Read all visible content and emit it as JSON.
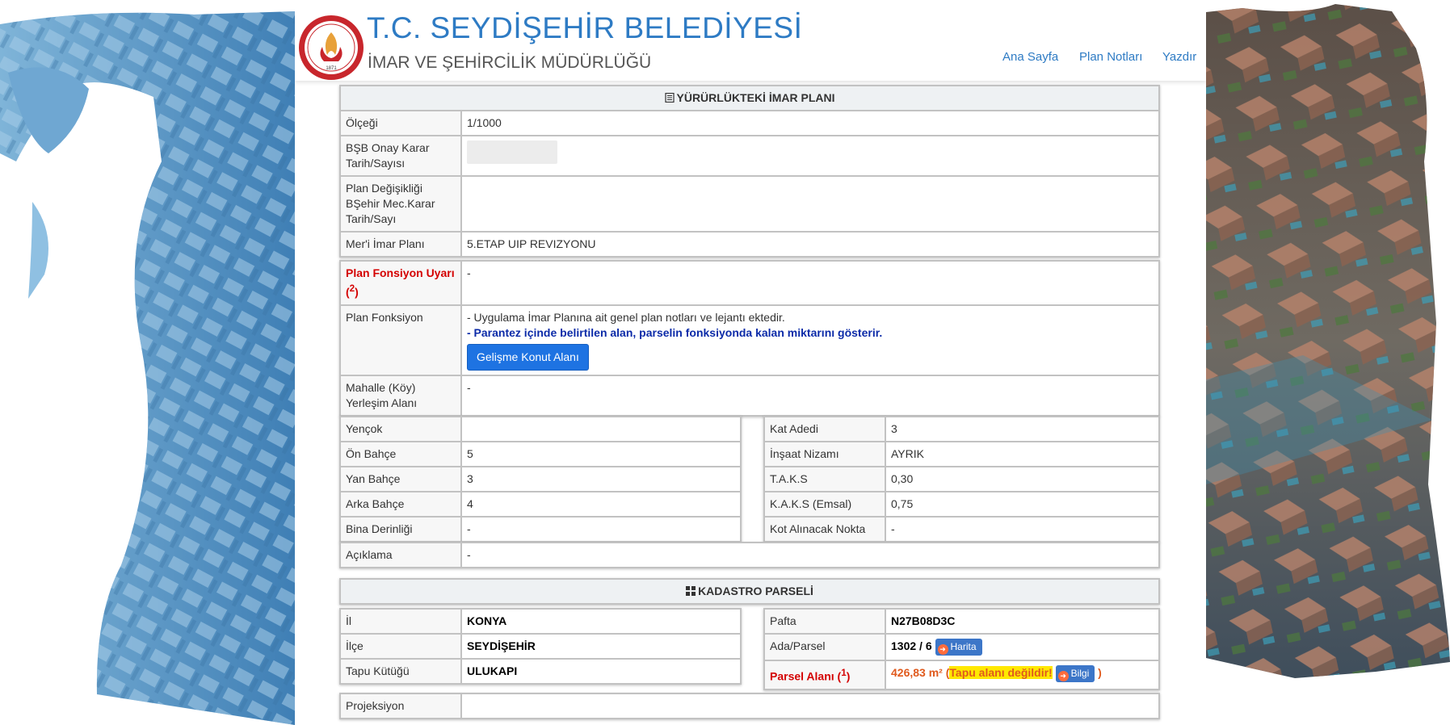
{
  "header": {
    "title": "T.C. SEYDİŞEHİR BELEDİYESİ",
    "subtitle": "İMAR VE ŞEHİRCİLİK MÜDÜRLÜĞÜ",
    "logo_text": "SEYDİŞEHİR BELEDİYE BAŞKANLIĞI",
    "logo_year": "1871",
    "nav": [
      "Ana Sayfa",
      "Plan Notları",
      "Yazdır"
    ]
  },
  "plan": {
    "section_title": "YÜRÜRLÜKTEKİ İMAR PLANI",
    "section_icon": "document-icon",
    "rows": [
      {
        "label": "Ölçeği",
        "value": "1/1000"
      },
      {
        "label": "BŞB Onay Karar Tarih/Sayısı",
        "value": ""
      },
      {
        "label": "Plan Değişikliği BŞehir Mec.Karar Tarih/Sayı",
        "value": ""
      },
      {
        "label": "Mer'i İmar Planı",
        "value": "5.ETAP UIP REVIZYONU"
      }
    ]
  },
  "function": {
    "warning_label": "Plan Fonsiyon Uyarı",
    "warning_ref": "2",
    "warning_value": "-",
    "plan_label": "Plan Fonksiyon",
    "plan_text": "- Uygulama İmar Planına ait genel plan notları ve lejantı ektedir.",
    "plan_note": "- Parantez içinde belirtilen alan, parselin fonksiyonda kalan miktarını gösterir.",
    "plan_button": "Gelişme Konut Alanı",
    "mahalle_label": "Mahalle (Köy) Yerleşim Alanı",
    "mahalle_value": "-"
  },
  "setbacks": {
    "left": [
      {
        "label": "Yençok",
        "value": ""
      },
      {
        "label": "Ön Bahçe",
        "value": "5"
      },
      {
        "label": "Yan Bahçe",
        "value": "3"
      },
      {
        "label": "Arka Bahçe",
        "value": "4"
      },
      {
        "label": "Bina Derinliği",
        "value": "-"
      }
    ],
    "right": [
      {
        "label": "Kat Adedi",
        "value": "3"
      },
      {
        "label": "İnşaat Nizamı",
        "value": "AYRIK"
      },
      {
        "label": "T.A.K.S",
        "value": "0,30"
      },
      {
        "label": "K.A.K.S (Emsal)",
        "value": "0,75"
      },
      {
        "label": "Kot Alınacak Nokta",
        "value": "-"
      }
    ]
  },
  "aciklama": {
    "label": "Açıklama",
    "value": "-"
  },
  "kadastro": {
    "section_title": "KADASTRO PARSELİ",
    "section_icon": "grid-icon",
    "left": [
      {
        "label": "İl",
        "value": "KONYA"
      },
      {
        "label": "İlçe",
        "value": "SEYDİŞEHİR"
      },
      {
        "label": "Tapu Kütüğü",
        "value": "ULUKAPI"
      }
    ],
    "pafta_label": "Pafta",
    "pafta_value": "N27B08D3C",
    "ada_label": "Ada/Parsel",
    "ada_value": "1302 / 6",
    "harita_button": "Harita",
    "parsel_label": "Parsel Alanı",
    "parsel_ref": "1",
    "parsel_area": "426,83 m²",
    "parsel_warning": "Tapu alanı değildir!",
    "bilgi_button": "Bilgi",
    "projeksiyon_label": "Projeksiyon"
  },
  "colors": {
    "brand": "#2e7bc4",
    "button": "#1e73e2",
    "warning": "#d40000",
    "area": "#e05a1d",
    "highlight": "#ffe800"
  }
}
